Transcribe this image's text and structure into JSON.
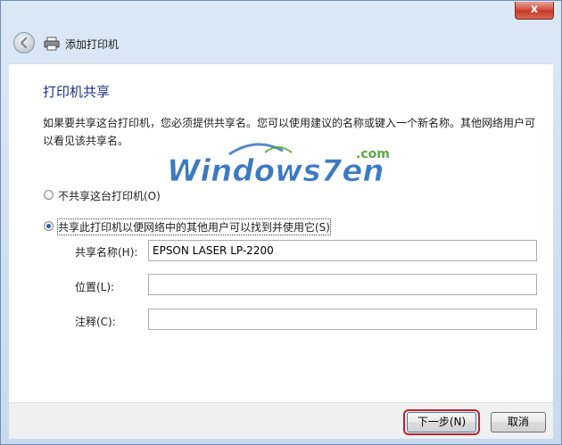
{
  "window": {
    "title_bar": {
      "close_label": "x"
    },
    "nav": {
      "title": "添加打印机"
    }
  },
  "page": {
    "heading": "打印机共享",
    "description": "如果要共享这台打印机，您必须提供共享名。您可以使用建议的名称或键入一个新名称。其他网络用户可以看见该共享名。"
  },
  "options": [
    {
      "label": "不共享这台打印机(O)",
      "selected": false
    },
    {
      "label": "共享此打印机以便网络中的其他用户可以找到并使用它(S)",
      "selected": true
    }
  ],
  "fields": {
    "share_name": {
      "label": "共享名称(H):",
      "value": "EPSON LASER LP-2200"
    },
    "location": {
      "label": "位置(L):",
      "value": ""
    },
    "comment": {
      "label": "注释(C):",
      "value": ""
    }
  },
  "watermark": {
    "text": "Windows7en",
    "suffix": ".com"
  },
  "buttons": {
    "next": "下一步(N)",
    "cancel": "取消"
  },
  "colors": {
    "heading": "#1e3287",
    "highlight_outline": "#c0202a",
    "watermark_blue": "#1b63b8",
    "watermark_green": "#4aa02c"
  }
}
